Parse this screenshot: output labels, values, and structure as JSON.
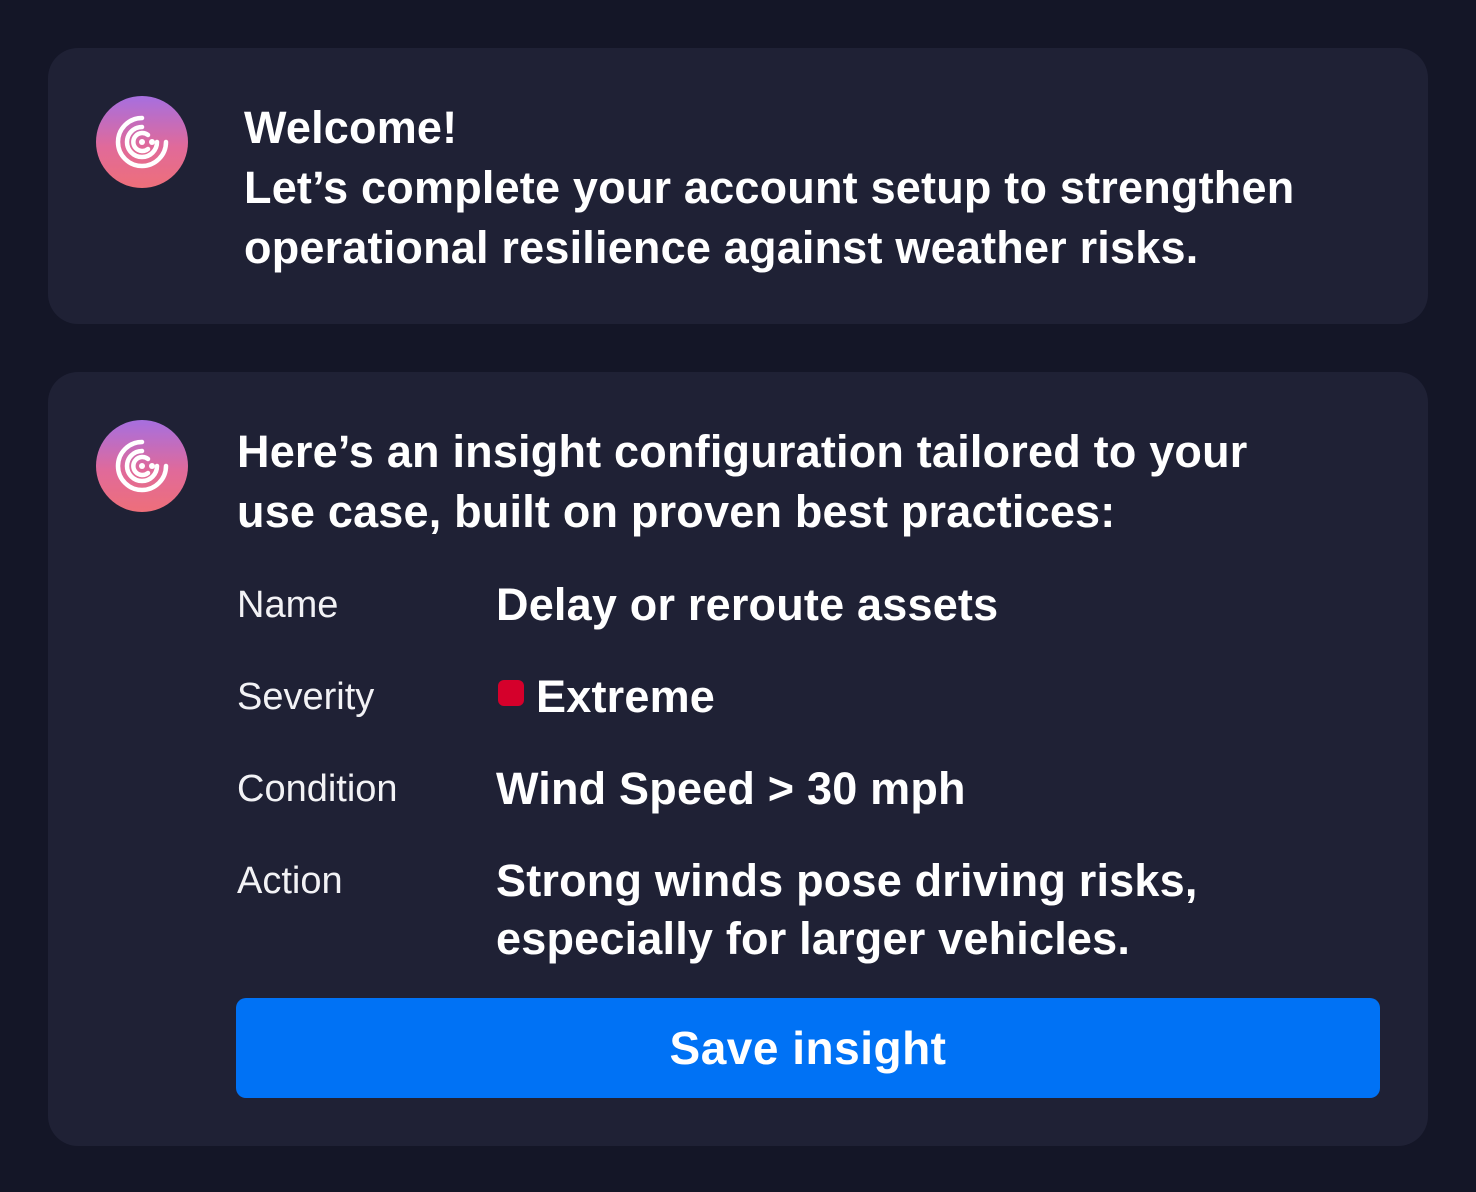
{
  "welcome": {
    "avatar_icon": "assistant-spiral-icon",
    "title": "Welcome!",
    "message_line1": "Let’s complete your account setup to strengthen",
    "message_line2": "operational resilience against weather risks."
  },
  "insight": {
    "avatar_icon": "assistant-spiral-icon",
    "intro_line1": "Here’s an insight configuration tailored to your",
    "intro_line2": "use case, built on proven best practices:",
    "fields": {
      "name": {
        "label": "Name",
        "value": "Delay or reroute assets"
      },
      "severity": {
        "label": "Severity",
        "value": "Extreme",
        "color": "#d5002b"
      },
      "condition": {
        "label": "Condition",
        "value": "Wind Speed > 30 mph"
      },
      "action": {
        "label": "Action",
        "value_line1": "Strong winds pose driving risks,",
        "value_line2": "especially for larger vehicles."
      }
    },
    "save_label": "Save insight"
  },
  "colors": {
    "background": "#141627",
    "card": "#1f2135",
    "button": "#0072f5",
    "avatar_gradient_top": "#a66fe0",
    "avatar_gradient_bottom": "#ee6f7a"
  }
}
